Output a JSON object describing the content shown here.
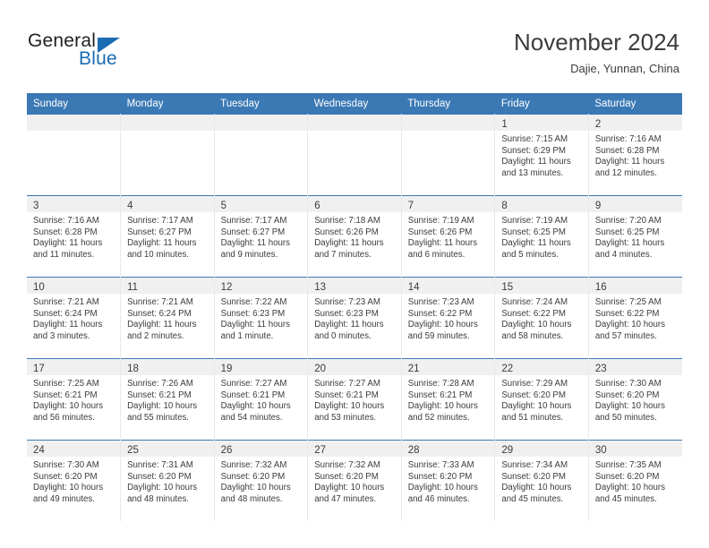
{
  "brand": {
    "name_part1": "General",
    "name_part2": "Blue",
    "accent_color": "#1b6cb3",
    "triangle_icon": "brand-triangle-icon"
  },
  "header": {
    "title": "November 2024",
    "subtitle": "Dajie, Yunnan, China"
  },
  "theme": {
    "header_blue": "#3b79b5",
    "row_band_gray": "#f0f0f0",
    "text_gray": "#3c3c3c"
  },
  "calendar": {
    "day_headers": [
      "Sunday",
      "Monday",
      "Tuesday",
      "Wednesday",
      "Thursday",
      "Friday",
      "Saturday"
    ],
    "labels": {
      "sunrise": "Sunrise:",
      "sunset": "Sunset:",
      "daylight": "Daylight:"
    },
    "weeks": [
      [
        {
          "empty": true
        },
        {
          "empty": true
        },
        {
          "empty": true
        },
        {
          "empty": true
        },
        {
          "empty": true
        },
        {
          "day": "1",
          "sunrise": "Sunrise: 7:15 AM",
          "sunset": "Sunset: 6:29 PM",
          "daylight_line1": "Daylight: 11 hours",
          "daylight_line2": "and 13 minutes."
        },
        {
          "day": "2",
          "sunrise": "Sunrise: 7:16 AM",
          "sunset": "Sunset: 6:28 PM",
          "daylight_line1": "Daylight: 11 hours",
          "daylight_line2": "and 12 minutes."
        }
      ],
      [
        {
          "day": "3",
          "sunrise": "Sunrise: 7:16 AM",
          "sunset": "Sunset: 6:28 PM",
          "daylight_line1": "Daylight: 11 hours",
          "daylight_line2": "and 11 minutes."
        },
        {
          "day": "4",
          "sunrise": "Sunrise: 7:17 AM",
          "sunset": "Sunset: 6:27 PM",
          "daylight_line1": "Daylight: 11 hours",
          "daylight_line2": "and 10 minutes."
        },
        {
          "day": "5",
          "sunrise": "Sunrise: 7:17 AM",
          "sunset": "Sunset: 6:27 PM",
          "daylight_line1": "Daylight: 11 hours",
          "daylight_line2": "and 9 minutes."
        },
        {
          "day": "6",
          "sunrise": "Sunrise: 7:18 AM",
          "sunset": "Sunset: 6:26 PM",
          "daylight_line1": "Daylight: 11 hours",
          "daylight_line2": "and 7 minutes."
        },
        {
          "day": "7",
          "sunrise": "Sunrise: 7:19 AM",
          "sunset": "Sunset: 6:26 PM",
          "daylight_line1": "Daylight: 11 hours",
          "daylight_line2": "and 6 minutes."
        },
        {
          "day": "8",
          "sunrise": "Sunrise: 7:19 AM",
          "sunset": "Sunset: 6:25 PM",
          "daylight_line1": "Daylight: 11 hours",
          "daylight_line2": "and 5 minutes."
        },
        {
          "day": "9",
          "sunrise": "Sunrise: 7:20 AM",
          "sunset": "Sunset: 6:25 PM",
          "daylight_line1": "Daylight: 11 hours",
          "daylight_line2": "and 4 minutes."
        }
      ],
      [
        {
          "day": "10",
          "sunrise": "Sunrise: 7:21 AM",
          "sunset": "Sunset: 6:24 PM",
          "daylight_line1": "Daylight: 11 hours",
          "daylight_line2": "and 3 minutes."
        },
        {
          "day": "11",
          "sunrise": "Sunrise: 7:21 AM",
          "sunset": "Sunset: 6:24 PM",
          "daylight_line1": "Daylight: 11 hours",
          "daylight_line2": "and 2 minutes."
        },
        {
          "day": "12",
          "sunrise": "Sunrise: 7:22 AM",
          "sunset": "Sunset: 6:23 PM",
          "daylight_line1": "Daylight: 11 hours",
          "daylight_line2": "and 1 minute."
        },
        {
          "day": "13",
          "sunrise": "Sunrise: 7:23 AM",
          "sunset": "Sunset: 6:23 PM",
          "daylight_line1": "Daylight: 11 hours",
          "daylight_line2": "and 0 minutes."
        },
        {
          "day": "14",
          "sunrise": "Sunrise: 7:23 AM",
          "sunset": "Sunset: 6:22 PM",
          "daylight_line1": "Daylight: 10 hours",
          "daylight_line2": "and 59 minutes."
        },
        {
          "day": "15",
          "sunrise": "Sunrise: 7:24 AM",
          "sunset": "Sunset: 6:22 PM",
          "daylight_line1": "Daylight: 10 hours",
          "daylight_line2": "and 58 minutes."
        },
        {
          "day": "16",
          "sunrise": "Sunrise: 7:25 AM",
          "sunset": "Sunset: 6:22 PM",
          "daylight_line1": "Daylight: 10 hours",
          "daylight_line2": "and 57 minutes."
        }
      ],
      [
        {
          "day": "17",
          "sunrise": "Sunrise: 7:25 AM",
          "sunset": "Sunset: 6:21 PM",
          "daylight_line1": "Daylight: 10 hours",
          "daylight_line2": "and 56 minutes."
        },
        {
          "day": "18",
          "sunrise": "Sunrise: 7:26 AM",
          "sunset": "Sunset: 6:21 PM",
          "daylight_line1": "Daylight: 10 hours",
          "daylight_line2": "and 55 minutes."
        },
        {
          "day": "19",
          "sunrise": "Sunrise: 7:27 AM",
          "sunset": "Sunset: 6:21 PM",
          "daylight_line1": "Daylight: 10 hours",
          "daylight_line2": "and 54 minutes."
        },
        {
          "day": "20",
          "sunrise": "Sunrise: 7:27 AM",
          "sunset": "Sunset: 6:21 PM",
          "daylight_line1": "Daylight: 10 hours",
          "daylight_line2": "and 53 minutes."
        },
        {
          "day": "21",
          "sunrise": "Sunrise: 7:28 AM",
          "sunset": "Sunset: 6:21 PM",
          "daylight_line1": "Daylight: 10 hours",
          "daylight_line2": "and 52 minutes."
        },
        {
          "day": "22",
          "sunrise": "Sunrise: 7:29 AM",
          "sunset": "Sunset: 6:20 PM",
          "daylight_line1": "Daylight: 10 hours",
          "daylight_line2": "and 51 minutes."
        },
        {
          "day": "23",
          "sunrise": "Sunrise: 7:30 AM",
          "sunset": "Sunset: 6:20 PM",
          "daylight_line1": "Daylight: 10 hours",
          "daylight_line2": "and 50 minutes."
        }
      ],
      [
        {
          "day": "24",
          "sunrise": "Sunrise: 7:30 AM",
          "sunset": "Sunset: 6:20 PM",
          "daylight_line1": "Daylight: 10 hours",
          "daylight_line2": "and 49 minutes."
        },
        {
          "day": "25",
          "sunrise": "Sunrise: 7:31 AM",
          "sunset": "Sunset: 6:20 PM",
          "daylight_line1": "Daylight: 10 hours",
          "daylight_line2": "and 48 minutes."
        },
        {
          "day": "26",
          "sunrise": "Sunrise: 7:32 AM",
          "sunset": "Sunset: 6:20 PM",
          "daylight_line1": "Daylight: 10 hours",
          "daylight_line2": "and 48 minutes."
        },
        {
          "day": "27",
          "sunrise": "Sunrise: 7:32 AM",
          "sunset": "Sunset: 6:20 PM",
          "daylight_line1": "Daylight: 10 hours",
          "daylight_line2": "and 47 minutes."
        },
        {
          "day": "28",
          "sunrise": "Sunrise: 7:33 AM",
          "sunset": "Sunset: 6:20 PM",
          "daylight_line1": "Daylight: 10 hours",
          "daylight_line2": "and 46 minutes."
        },
        {
          "day": "29",
          "sunrise": "Sunrise: 7:34 AM",
          "sunset": "Sunset: 6:20 PM",
          "daylight_line1": "Daylight: 10 hours",
          "daylight_line2": "and 45 minutes."
        },
        {
          "day": "30",
          "sunrise": "Sunrise: 7:35 AM",
          "sunset": "Sunset: 6:20 PM",
          "daylight_line1": "Daylight: 10 hours",
          "daylight_line2": "and 45 minutes."
        }
      ]
    ]
  }
}
